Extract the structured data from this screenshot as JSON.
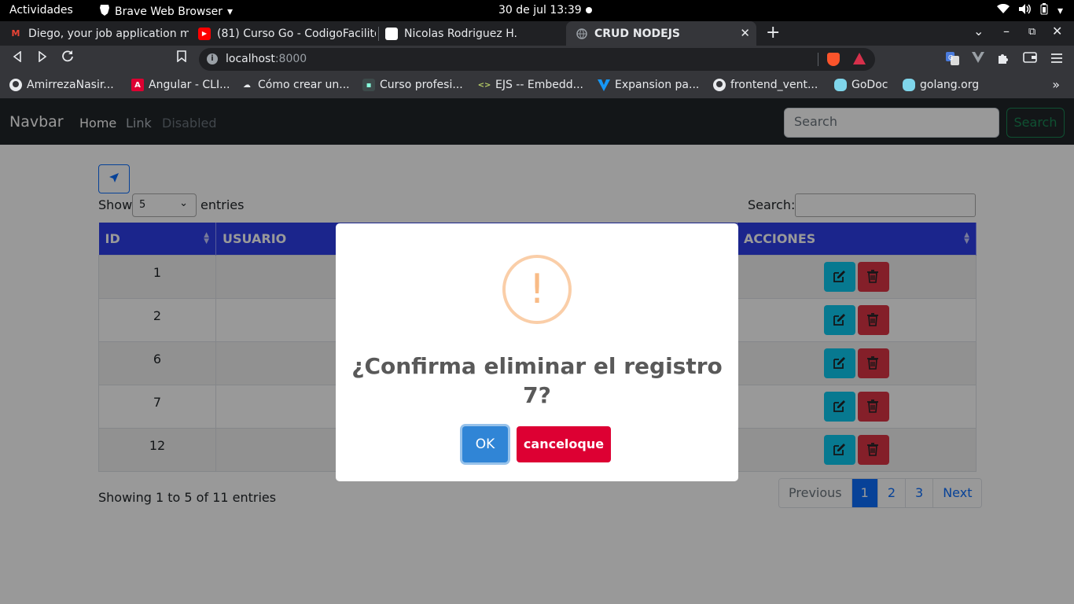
{
  "system_bar": {
    "activities": "Actividades",
    "app_name": "Brave Web Browser",
    "clock": "30 de jul  13:39"
  },
  "tabs": [
    {
      "title": "Diego, your job application m",
      "favicon": "gmail-icon",
      "favicon_color": "#ea4335"
    },
    {
      "title": "(81) Curso Go - CodigoFacilito",
      "favicon": "youtube-icon",
      "favicon_color": "#ff0000"
    },
    {
      "title": "Nicolas Rodriguez H.",
      "favicon": "page-icon",
      "favicon_color": "#ffffff"
    },
    {
      "title": "CRUD NODEJS",
      "favicon": "globe-icon",
      "favicon_color": "#9aa0a6",
      "active": true
    }
  ],
  "address_bar": {
    "host": "localhost",
    "port": ":8000"
  },
  "bookmarks": [
    {
      "label": "AmirrezaNasir...",
      "icon": "github-icon"
    },
    {
      "label": "Angular - CLI...",
      "icon": "angular-icon"
    },
    {
      "label": "Cómo crear un...",
      "icon": "cloud-icon"
    },
    {
      "label": "Curso profesi...",
      "icon": "page-icon"
    },
    {
      "label": "EJS -- Embedd...",
      "icon": "ejs-icon"
    },
    {
      "label": "Expansion pa...",
      "icon": "vuetify-icon"
    },
    {
      "label": "frontend_vent...",
      "icon": "github-icon"
    },
    {
      "label": "GoDoc",
      "icon": "gopher-icon"
    },
    {
      "label": "golang.org",
      "icon": "gopher-icon"
    }
  ],
  "navbar": {
    "brand": "Navbar",
    "links": [
      "Home",
      "Link",
      "Disabled"
    ],
    "search_placeholder": "Search",
    "search_button": "Search"
  },
  "datatable": {
    "show_label": "Show",
    "page_length": "5",
    "entries_label": "entries",
    "search_label": "Search:",
    "columns": [
      "ID",
      "USUARIO",
      "ACCIONES"
    ],
    "column_partial_visible": "CCIONES",
    "rows": [
      {
        "id": "1"
      },
      {
        "id": "2"
      },
      {
        "id": "6"
      },
      {
        "id": "7"
      },
      {
        "id": "12"
      }
    ],
    "info": "Showing 1 to 5 of 11 entries",
    "pagination": {
      "previous": "Previous",
      "pages": [
        "1",
        "2",
        "3"
      ],
      "current": "1",
      "next": "Next"
    }
  },
  "modal": {
    "icon": "!",
    "title": "¿Confirma eliminar el registro 7?",
    "ok_label": "OK",
    "cancel_label": "canceloque"
  },
  "colors": {
    "table_header": "#2e3eea",
    "edit_button": "#0dcaf0",
    "delete_button": "#dc3545",
    "ok_button": "#3085d6",
    "cancel_button": "#dd0033"
  }
}
